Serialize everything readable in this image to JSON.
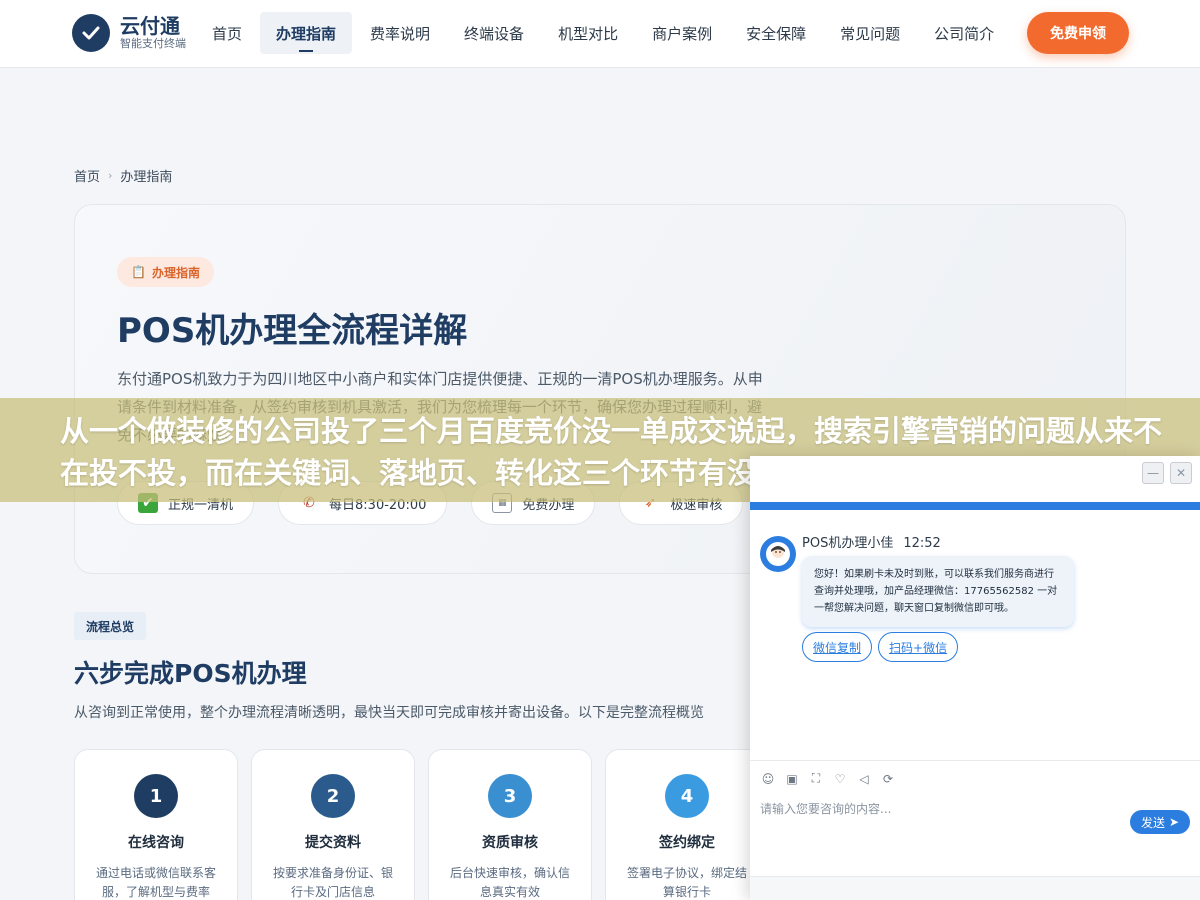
{
  "header": {
    "logo_name": "云付通",
    "logo_tag": "智能支付终端",
    "nav": [
      {
        "label": "首页"
      },
      {
        "label": "办理指南",
        "active": true
      },
      {
        "label": "费率说明"
      },
      {
        "label": "终端设备"
      },
      {
        "label": "机型对比"
      },
      {
        "label": "商户案例"
      },
      {
        "label": "安全保障"
      },
      {
        "label": "常见问题"
      },
      {
        "label": "公司简介"
      }
    ],
    "cta_label": "免费申领"
  },
  "breadcrumb": {
    "home": "首页",
    "current": "办理指南"
  },
  "hero": {
    "badge": "办理指南",
    "title": "POS机办理全流程详解",
    "description": "东付通POS机致力于为四川地区中小商户和实体门店提供便捷、正规的一清POS机办理服务。从申请条件到材料准备，从签约审核到机具激活，我们为您梳理每一个环节，确保您办理过程顺利，避免不必要的麻烦。",
    "features": [
      {
        "icon": "checkmark-icon",
        "label": "正规一清机"
      },
      {
        "icon": "phone-icon",
        "label": "每日8:30-20:00"
      },
      {
        "icon": "free-icon",
        "label": "免费办理"
      },
      {
        "icon": "rocket-icon",
        "label": "极速审核"
      }
    ]
  },
  "overview": {
    "tag": "流程总览",
    "title": "六步完成POS机办理",
    "description": "从咨询到正常使用，整个办理流程清晰透明，最快当天即可完成审核并寄出设备。以下是完整流程概览",
    "steps": [
      {
        "num": "1",
        "title": "在线咨询",
        "desc": "通过电话或微信联系客服，了解机型与费率",
        "color": "#1f3c63"
      },
      {
        "num": "2",
        "title": "提交资料",
        "desc": "按要求准备身份证、银行卡及门店信息",
        "color": "#2a5b8c"
      },
      {
        "num": "3",
        "title": "资质审核",
        "desc": "后台快速审核，确认信息真实有效",
        "color": "#3a8fd1"
      },
      {
        "num": "4",
        "title": "签约绑定",
        "desc": "签署电子协议，绑定结算银行卡",
        "color": "#3b9be0"
      }
    ]
  },
  "marquee": {
    "text": "从一个做装修的公司投了三个月百度竞价没一单成交说起，搜索引擎营销的问题从来不在投不投，而在关键词、落地页、转化这三个环节有没有串"
  },
  "chat": {
    "agent_name": "POS机办理小佳",
    "time": "12:52",
    "message": "您好！如果刷卡未及时到账，可以联系我们服务商进行查询并处理哦，加产品经理微信：17765562582 一对一帮您解决问题，聊天窗口复制微信即可哦。",
    "actions": [
      {
        "label": "微信复制"
      },
      {
        "label": "扫码+微信"
      }
    ],
    "input_placeholder": "请输入您要咨询的内容...",
    "send_label": "发送",
    "tools": [
      "emoji-icon",
      "image-icon",
      "screenshot-icon",
      "rating-icon",
      "voice-icon",
      "switch-icon"
    ]
  }
}
